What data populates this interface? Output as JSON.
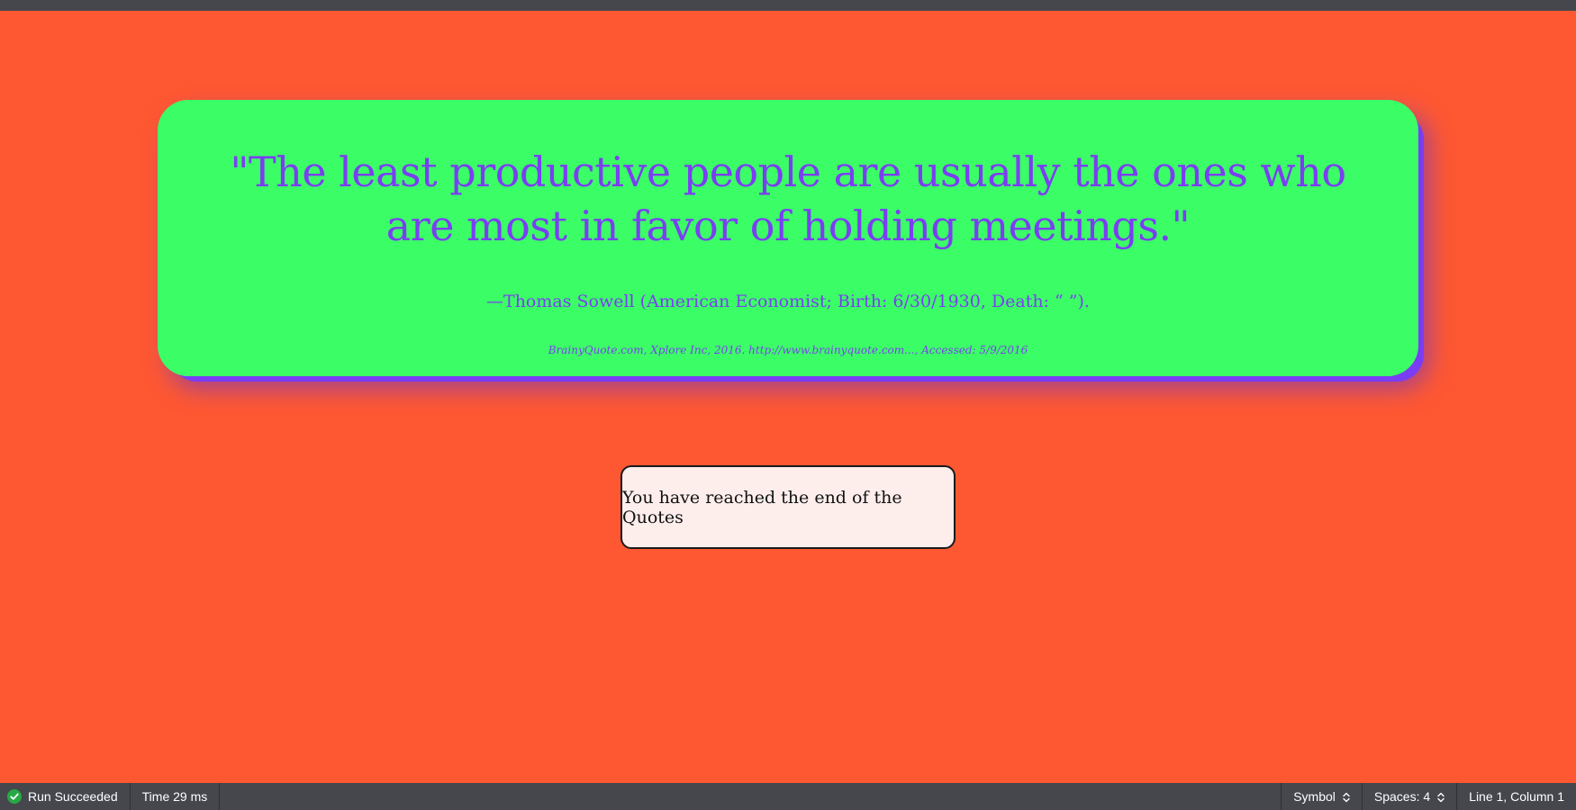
{
  "quote": {
    "text": "\"The least productive people are usually the ones who are most in favor of holding meetings.\"",
    "author": "—Thomas Sowell (American Economist; Birth: 6/30/1930, Death: “ ”).",
    "source": "BrainyQuote.com, Xplore Inc, 2016. http://www.brainyquote.com..., Accessed: 5/9/2016"
  },
  "end_message": "You have reached the end of the Quotes",
  "status_bar": {
    "run_status": "Run Succeeded",
    "time": "Time 29 ms",
    "language": "Symbol",
    "indent": "Spaces: 4",
    "cursor": "Line 1, Column 1"
  },
  "icons": {
    "run_status": "check-circle-icon",
    "language": "stepper-icon",
    "indent": "stepper-icon"
  },
  "colors": {
    "page_background": "#fe5832",
    "card_background": "#3bfe66",
    "card_text": "#7b3ef2",
    "end_box_background": "#fdeeec",
    "status_bar": "#45474d",
    "success": "#27a844"
  }
}
